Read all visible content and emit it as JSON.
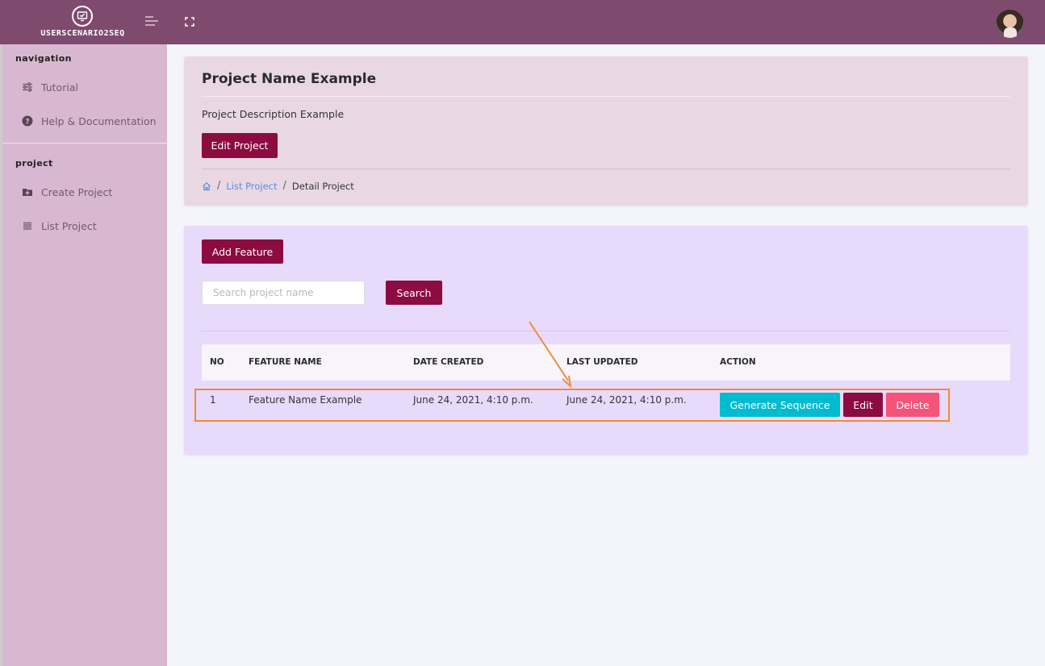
{
  "app": {
    "brand_name": "USERSCENARIO2SEQ",
    "brand_icon": "monitor-check-icon"
  },
  "header": {
    "menu_icon": "hamburger-icon",
    "fullscreen_icon": "fullscreen-icon",
    "avatar": "user-avatar"
  },
  "sidebar": {
    "sections": [
      {
        "title": "navigation",
        "items": [
          {
            "label": "Tutorial",
            "icon": "sliders-icon"
          },
          {
            "label": "Help & Documentation",
            "icon": "help-circle-icon"
          }
        ]
      },
      {
        "title": "project",
        "items": [
          {
            "label": "Create Project",
            "icon": "folder-plus-icon"
          },
          {
            "label": "List Project",
            "icon": "list-icon"
          }
        ]
      }
    ]
  },
  "project": {
    "title": "Project Name Example",
    "description": "Project Description Example",
    "edit_label": "Edit Project"
  },
  "breadcrumb": {
    "home_icon": "home-icon",
    "items": [
      "List Project",
      "Detail Project"
    ],
    "separator": "/"
  },
  "features": {
    "add_label": "Add Feature",
    "search_placeholder": "Search project name",
    "search_label": "Search",
    "columns": [
      "NO",
      "FEATURE NAME",
      "DATE CREATED",
      "LAST UPDATED",
      "ACTION"
    ],
    "rows": [
      {
        "no": "1",
        "name": "Feature Name Example",
        "created": "June 24, 2021, 4:10 p.m.",
        "updated": "June 24, 2021, 4:10 p.m."
      }
    ],
    "actions": {
      "generate": "Generate Sequence",
      "edit": "Edit",
      "delete": "Delete"
    }
  },
  "colors": {
    "topbar": "#7e4a6e",
    "sidebar": "#d8b8d1",
    "primary": "#8c0b40",
    "info": "#00bcd0",
    "danger": "#f5537a",
    "annotation": "#f08b36"
  }
}
